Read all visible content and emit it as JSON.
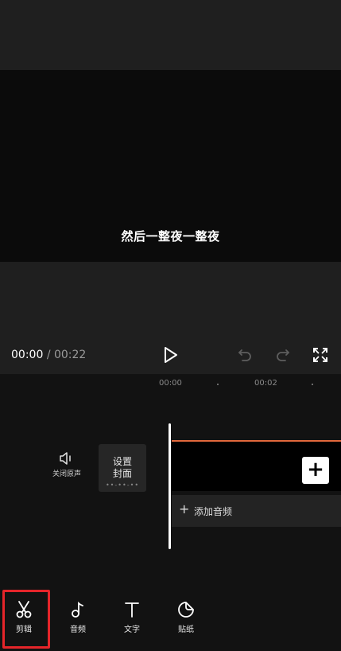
{
  "preview": {
    "subtitle": "然后一整夜一整夜"
  },
  "player": {
    "current_time": "00:00",
    "separator": "/",
    "total_time": "00:22"
  },
  "timeline": {
    "ruler_labels": [
      "00:00",
      "00:02"
    ],
    "mute_label": "关闭原声",
    "cover_label": "设置封面",
    "cover_dots": "••-••-••",
    "add_clip_symbol": "+",
    "add_audio_symbol": "+",
    "add_audio_label": "添加音频",
    "clip_border_color": "#e2683c"
  },
  "toolbar": {
    "items": [
      {
        "label": "剪辑",
        "icon": "scissors-icon",
        "selected": true
      },
      {
        "label": "音频",
        "icon": "music-note-icon"
      },
      {
        "label": "文字",
        "icon": "text-t-icon"
      },
      {
        "label": "贴纸",
        "icon": "sticker-icon"
      }
    ],
    "highlight_color": "#e5252a"
  }
}
